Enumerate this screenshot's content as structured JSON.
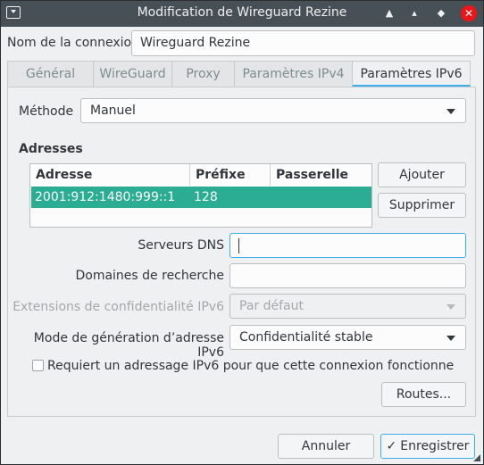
{
  "window": {
    "title": "Modification de Wireguard Rezine"
  },
  "titlebar_buttons": {
    "minimize": "▲",
    "restore": "▴",
    "maximize": "◆",
    "close": "✕"
  },
  "connection": {
    "label": "Nom de la connexion",
    "value": "Wireguard Rezine"
  },
  "tabs": [
    {
      "label": "Général",
      "active": false
    },
    {
      "label": "WireGuard",
      "active": false
    },
    {
      "label": "Proxy",
      "active": false
    },
    {
      "label": "Paramètres IPv4",
      "active": false
    },
    {
      "label": "Paramètres IPv6",
      "active": true
    }
  ],
  "method": {
    "label": "Méthode",
    "value": "Manuel"
  },
  "addresses": {
    "title": "Adresses",
    "columns": [
      "Adresse",
      "Préfixe",
      "Passerelle"
    ],
    "rows": [
      {
        "address": "2001:912:1480:999::1",
        "prefix": "128",
        "gateway": ""
      }
    ],
    "add_button": "Ajouter",
    "remove_button": "Supprimer"
  },
  "dns": {
    "label": "Serveurs DNS",
    "value": ""
  },
  "search_domains": {
    "label": "Domaines de recherche",
    "value": ""
  },
  "privacy": {
    "label": "Extensions de confidentialité IPv6",
    "value": "Par défaut"
  },
  "addr_gen_mode": {
    "label": "Mode de génération d’adresse IPv6",
    "value": "Confidentialité stable"
  },
  "require_ipv6": {
    "label": "Requiert un adressage IPv6 pour que cette connexion fonctionne",
    "checked": false
  },
  "routes_button": "Routes...",
  "footer": {
    "cancel": "Annuler",
    "save": "Enregistrer",
    "save_icon": "check-icon"
  },
  "colors": {
    "accent": "#3daee9",
    "selection": "#2bad93",
    "titlebar": "#475057",
    "close": "#ed1515"
  }
}
